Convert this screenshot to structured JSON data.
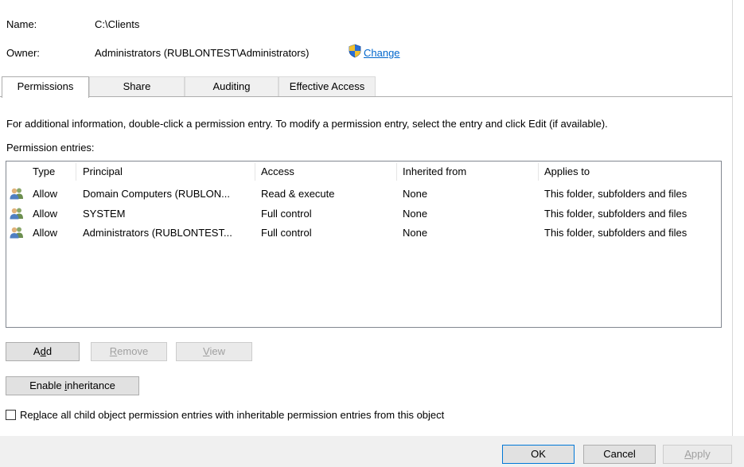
{
  "info": {
    "name_label": "Name:",
    "name_value": "C:\\Clients",
    "owner_label": "Owner:",
    "owner_value": "Administrators (RUBLONTEST\\Administrators)",
    "change_link": "Change"
  },
  "tabs": [
    {
      "label": "Permissions",
      "active": true
    },
    {
      "label": "Share",
      "active": false
    },
    {
      "label": "Auditing",
      "active": false
    },
    {
      "label": "Effective Access",
      "active": false
    }
  ],
  "instructions": "For additional information, double-click a permission entry. To modify a permission entry, select the entry and click Edit (if available).",
  "entries_label": "Permission entries:",
  "columns": [
    "Type",
    "Principal",
    "Access",
    "Inherited from",
    "Applies to"
  ],
  "rows": [
    {
      "type": "Allow",
      "principal": "Domain Computers (RUBLON...",
      "access": "Read & execute",
      "inherited": "None",
      "applies": "This folder, subfolders and files"
    },
    {
      "type": "Allow",
      "principal": "SYSTEM",
      "access": "Full control",
      "inherited": "None",
      "applies": "This folder, subfolders and files"
    },
    {
      "type": "Allow",
      "principal": "Administrators (RUBLONTEST...",
      "access": "Full control",
      "inherited": "None",
      "applies": "This folder, subfolders and files"
    }
  ],
  "buttons": {
    "add": {
      "pre": "A",
      "ul": "d",
      "post": "d"
    },
    "remove": {
      "pre": "",
      "ul": "R",
      "post": "emove"
    },
    "view": {
      "pre": "",
      "ul": "V",
      "post": "iew"
    },
    "enable_inheritance": {
      "pre": "Enable ",
      "ul": "i",
      "post": "nheritance"
    }
  },
  "replace_checkbox": {
    "pre": "Re",
    "ul": "p",
    "post": "lace all child object permission entries with inheritable permission entries from this object",
    "checked": false
  },
  "footer": {
    "ok": "OK",
    "cancel": "Cancel",
    "apply": {
      "ul": "A",
      "post": "pply"
    }
  },
  "colors": {
    "link": "#0066cc",
    "default_button_border": "#0078d7"
  },
  "icons": {
    "shield": "uac-shield-icon",
    "user": "user-group-icon"
  }
}
